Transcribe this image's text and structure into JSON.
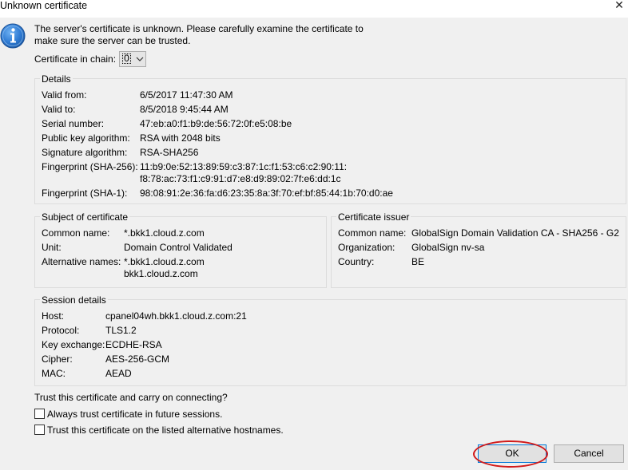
{
  "window": {
    "title": "Unknown certificate",
    "close_glyph": "✕"
  },
  "message": {
    "icon": "info-icon",
    "line1": "The server's certificate is unknown. Please carefully examine the certificate to",
    "line2": "make sure the server can be trusted."
  },
  "chain": {
    "label": "Certificate in chain:",
    "selected": "0"
  },
  "details": {
    "title": "Details",
    "rows": [
      {
        "label": "Valid from:",
        "value": "6/5/2017 11:47:30 AM"
      },
      {
        "label": "Valid to:",
        "value": "8/5/2018 9:45:44 AM"
      },
      {
        "label": "Serial number:",
        "value": "47:eb:a0:f1:b9:de:56:72:0f:e5:08:be"
      },
      {
        "label": "Public key algorithm:",
        "value": "RSA with 2048 bits"
      },
      {
        "label": "Signature algorithm:",
        "value": "RSA-SHA256"
      },
      {
        "label": "Fingerprint (SHA-256):",
        "value": "11:b9:0e:52:13:89:59:c3:87:1c:f1:53:c6:c2:90:11:",
        "value2": "f8:78:ac:73:f1:c9:91:d7:e8:d9:89:02:7f:e6:dd:1c"
      },
      {
        "label": "Fingerprint (SHA-1):",
        "value": "98:08:91:2e:36:fa:d6:23:35:8a:3f:70:ef:bf:85:44:1b:70:d0:ae"
      }
    ]
  },
  "subject": {
    "title": "Subject of certificate",
    "rows": [
      {
        "label": "Common name:",
        "value": "*.bkk1.cloud.z.com"
      },
      {
        "label": "Unit:",
        "value": "Domain Control Validated"
      },
      {
        "label": "Alternative names:",
        "value": "*.bkk1.cloud.z.com",
        "value2": "bkk1.cloud.z.com"
      }
    ]
  },
  "issuer": {
    "title": "Certificate issuer",
    "rows": [
      {
        "label": "Common name:",
        "value": "GlobalSign Domain Validation CA - SHA256 - G2"
      },
      {
        "label": "Organization:",
        "value": "GlobalSign nv-sa"
      },
      {
        "label": "Country:",
        "value": "BE"
      }
    ]
  },
  "session": {
    "title": "Session details",
    "rows": [
      {
        "label": "Host:",
        "value": "cpanel04wh.bkk1.cloud.z.com:21"
      },
      {
        "label": "Protocol:",
        "value": "TLS1.2"
      },
      {
        "label": "Key exchange:",
        "value": "ECDHE-RSA"
      },
      {
        "label": "Cipher:",
        "value": "AES-256-GCM"
      },
      {
        "label": "MAC:",
        "value": "AEAD"
      }
    ]
  },
  "trust": {
    "question": "Trust this certificate and carry on connecting?",
    "always": {
      "label": "Always trust certificate in future sessions.",
      "checked": false
    },
    "alt_hostnames": {
      "label": "Trust this certificate on the listed alternative hostnames.",
      "checked": false
    }
  },
  "buttons": {
    "ok": "OK",
    "cancel": "Cancel"
  },
  "colors": {
    "accent": "#0078d7",
    "highlight": "#d11a1a",
    "background": "#f0f0f0"
  }
}
